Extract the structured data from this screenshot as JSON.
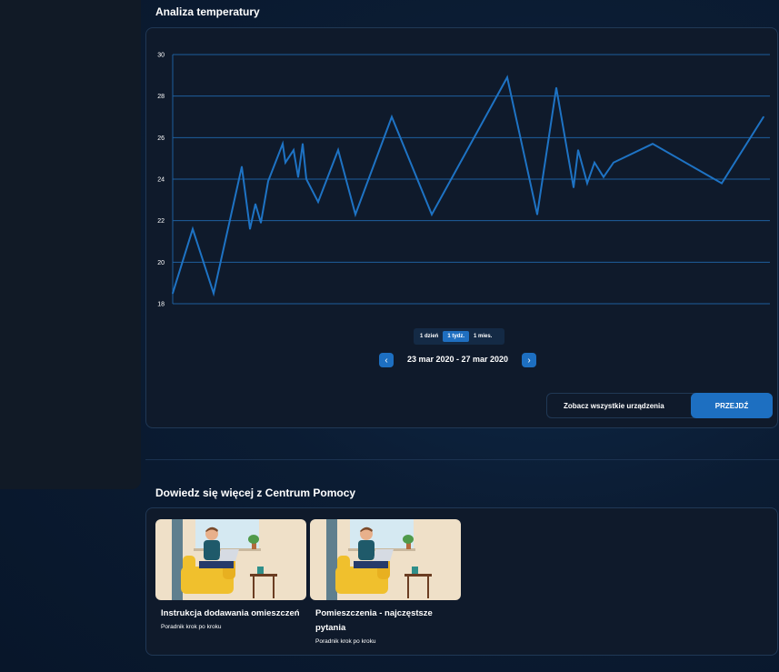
{
  "temperature": {
    "title": "Analiza temperatury",
    "ranges": [
      "1 dzień",
      "1 tydz.",
      "1 mies."
    ],
    "active_range": "1 tydz.",
    "date_range": "23 mar 2020 - 27 mar 2020",
    "devices_label": "Zobacz wszystkie urządzenia",
    "go_label": "PRZEJDŹ"
  },
  "chart_data": {
    "type": "line",
    "y_ticks": [
      30,
      28,
      26,
      24,
      22,
      20,
      18
    ],
    "ylim": [
      18,
      30
    ],
    "grid": true,
    "line_color": "#1e73c4",
    "series": [
      {
        "values": [
          18.5,
          21.6,
          18.5,
          24.6,
          21.6,
          22.8,
          21.9,
          23.9,
          25.7,
          24.8,
          25.4,
          24.1,
          25.7,
          24.0,
          22.9,
          25.4,
          22.3,
          27.0,
          22.3,
          28.9,
          22.3,
          28.4,
          23.6,
          25.4,
          23.8,
          24.8,
          24.1,
          24.8,
          25.7,
          23.8,
          27.0
        ]
      }
    ]
  },
  "help": {
    "title": "Dowiedz się więcej z Centrum Pomocy",
    "articles": [
      {
        "title": "Instrukcja dodawania omieszczeń",
        "subtitle": "Poradnik krok po kroku"
      },
      {
        "title": "Pomieszczenia - najczęstsze pytania",
        "subtitle": "Poradnik krok po kroku"
      }
    ]
  }
}
